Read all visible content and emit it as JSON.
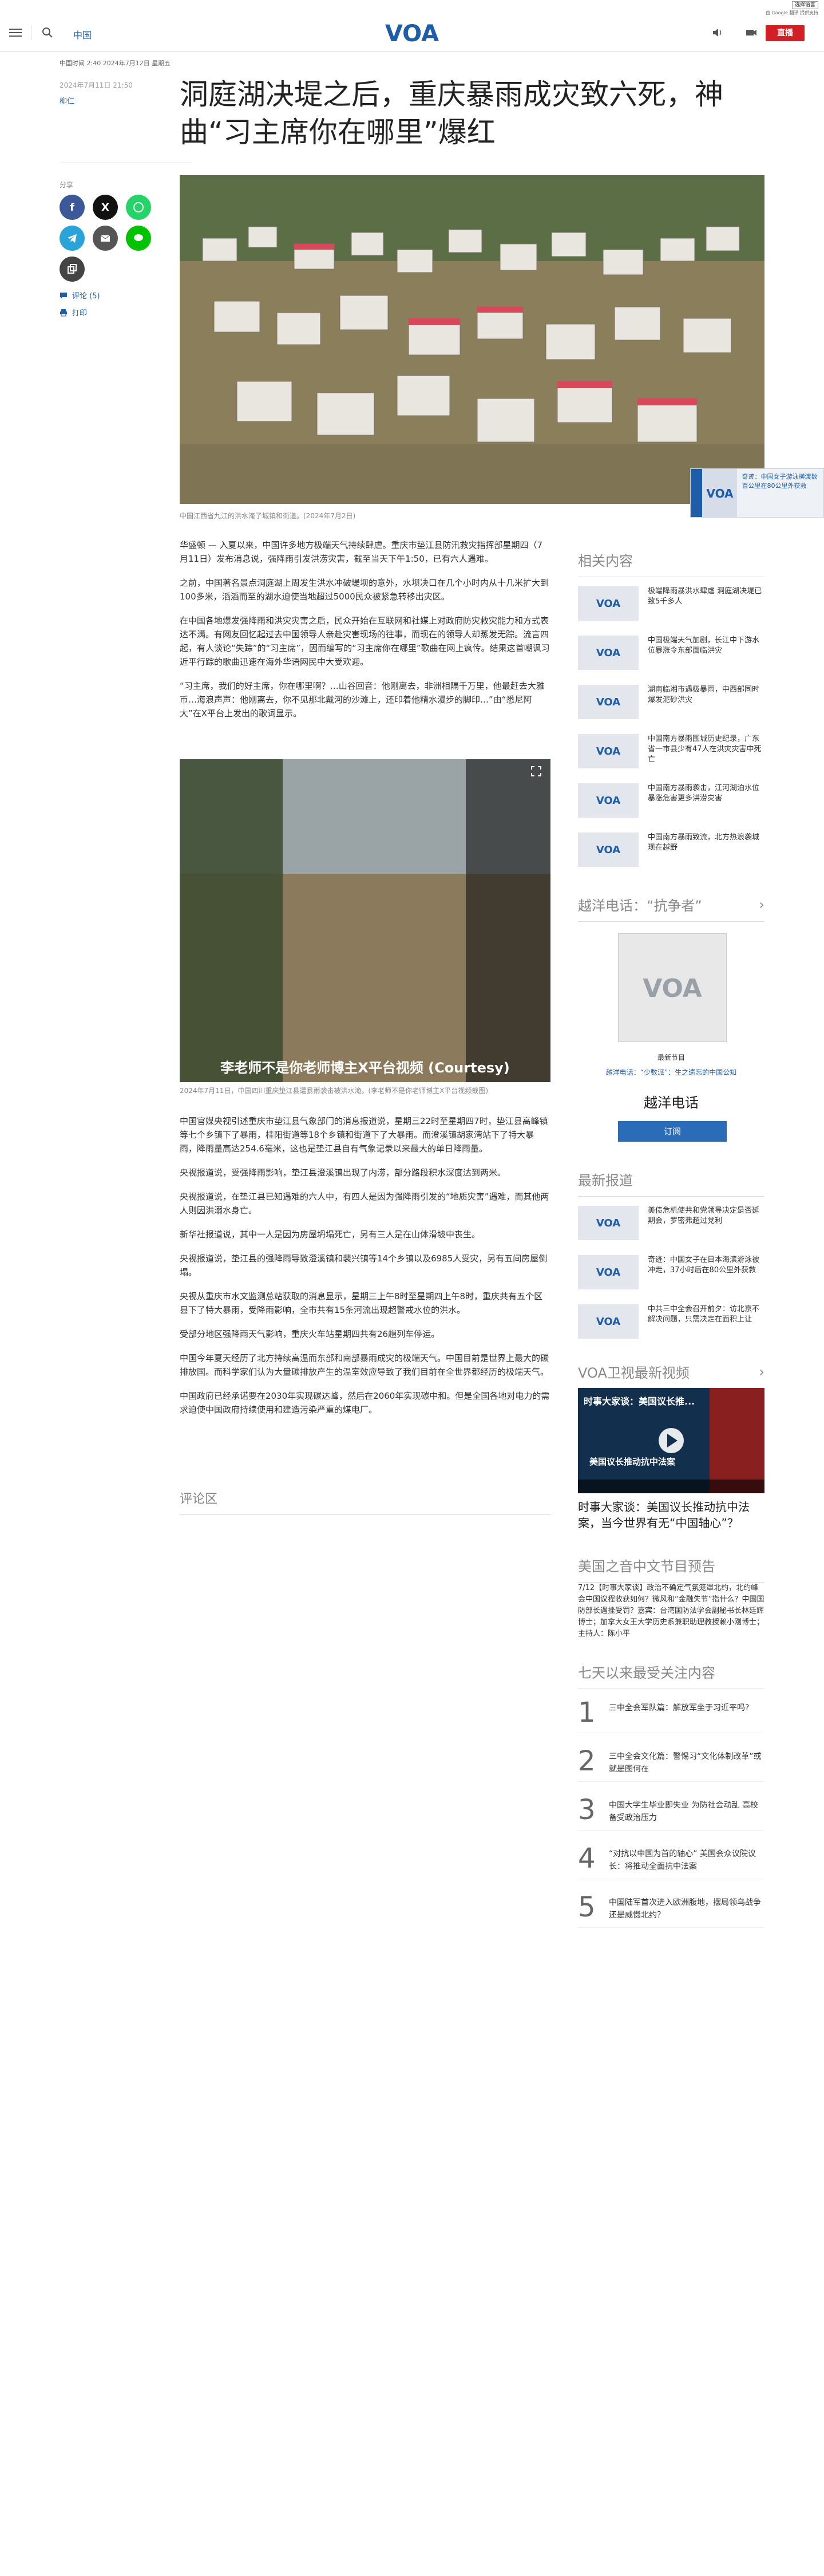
{
  "translate": {
    "select_label": "选择语言",
    "powered_by": "由 Google 翻译 提供支持"
  },
  "header": {
    "language_link": "中国",
    "live_label": "直播"
  },
  "article": {
    "dateline": "中国时间 2:40 2024年7月12日 星期五",
    "published": "2024年7月11日 21:50",
    "author": "柳仁",
    "headline": "洞庭湖决堤之后，重庆暴雨成灾致六死，神曲“习主席你在哪里”爆红",
    "share_label": "分享",
    "comments_label": "评论 (5)",
    "print_label": "打印",
    "lead_caption": "中国江西省九江的洪水淹了城镇和街道。(2024年7月2日)",
    "paragraphs_top": [
      "华盛顿 — 入夏以来，中国许多地方极端天气持续肆虐。重庆市垫江县防汛救灾指挥部星期四（7月11日）发布消息说，强降雨引发洪涝灾害，截至当天下午1:50，已有六人遇难。",
      "之前，中国著名景点洞庭湖上周发生洪水冲破堤坝的意外，水坝决口在几个小时内从十几米扩大到100多米，滔滔而至的湖水迫使当地超过5000民众被紧急转移出灾区。",
      "在中国各地爆发强降雨和洪灾灾害之后，民众开始在互联网和社媒上对政府防灾救灾能力和方式表达不满。有网友回忆起过去中国领导人亲赴灾害现场的往事，而现在的领导人却蒸发无踪。流言四起，有人谈论“失踪”的“习主席”，因而编写的“习主席你在哪里”歌曲在网上疯传。结果这首嘲讽习近平行踪的歌曲迅速在海外华语网民中大受欢迎。",
      "“习主席，我们的好主席，你在哪里啊？…山谷回音：他刚离去，非洲相隔千万里，他最赶去大雅币…海浪声声：他刚离去，你不见那北戴河的沙滩上，还印着他精水漫步的脚印…”由“悉尼阿大”在X平台上发出的歌词显示。"
    ],
    "video_overlay_text": "李老师不是你老师博主X平台视频 (Courtesy)",
    "video_caption": "2024年7月11日，中国四川重庆垫江县遭暴雨袭击被洪水淹。(李老师不是你老师博主X平台视频截图)",
    "paragraphs_bottom": [
      "中国官媒央视引述重庆市垫江县气象部门的消息报道说，星期三22时至星期四7时，垫江县高峰镇等七个乡镇下了暴雨，桂阳街道等18个乡镇和街道下了大暴雨。而澄溪镇胡家湾站下了特大暴雨，降雨量高达254.6毫米，这也是垫江县自有气象记录以来最大的单日降雨量。",
      "央视报道说，受强降雨影响，垫江县澄溪镇出现了内涝，部分路段积水深度达到两米。",
      "央视报道说，在垫江县已知遇难的六人中，有四人是因为强降雨引发的“地质灾害”遇难，而其他两人则因洪溺水身亡。",
      "新华社报道说，其中一人是因为房屋坍塌死亡，另有三人是在山体滑坡中丧生。",
      "央视报道说，垫江县的强降雨导致澄溪镇和裴兴镇等14个乡镇以及6985人受灾，另有五间房屋倒塌。",
      "央视从重庆市水文监测总站获取的消息显示，星期三上午8时至星期四上午8时，重庆共有五个区县下了特大暴雨，受降雨影响，全市共有15条河流出现超警戒水位的洪水。",
      "受部分地区强降雨天气影响，重庆火车站星期四共有26趟列车停运。",
      "中国今年夏天经历了北方持续高温而东部和南部暴雨成灾的极端天气。中国目前是世界上最大的碳排放国。而科学家们认为大量碳排放产生的温室效应导致了我们目前在全世界都经历的极端天气。",
      "中国政府已经承诺要在2030年实现碳达峰，然后在2060年实现碳中和。但是全国各地对电力的需求迫使中国政府持续使用和建造污染严重的煤电厂。"
    ],
    "comment_zone_label": "评论区"
  },
  "float_card": {
    "text": "奇迹：中国女子游泳横渡数百公里在80公里外获救"
  },
  "sidebar": {
    "related_heading": "相关内容",
    "related": [
      "极端降雨暴洪水肆虐 洞庭湖决堤已致5千多人",
      "中国极端天气加剧，长江中下游水位暴涨令东部面临洪灾",
      "湖南临湘市遇极暴雨，中西部同时爆发泥砂洪灾",
      "中国南方暴雨围城历史纪录，广东省一市县少有47人在洪灾灾害中死亡",
      "中国南方暴雨袭击，江河湖泊水位暴涨危害更多洪涝灾害",
      "中国南方暴雨致流，北方热浪袭城现在越野"
    ],
    "hotline_heading": "越洋电话：“抗争者”",
    "program_label": "最新节目",
    "program_line": "越洋电话：“少数派”：生之遗忘的中国公知",
    "program_name": "越洋电话",
    "subscribe_label": "订阅",
    "latest_heading": "最新报道",
    "latest": [
      "美债危机使共和党领导决定是否延期会，罗密弗超过党利",
      "奇迹：中国女子在日本海滨游泳被冲走，37小时后在80公里外获救",
      "中共三中全会召开前夕：访北京不解决问题，只需决定在面积上让"
    ],
    "tv_heading": "VOA卫视最新视频",
    "tv_video_overlay": "时事大家谈：美国议长推...",
    "tv_video_sub": "美国议长推动抗中法案",
    "tv_title": "时事大家谈：美国议长推动抗中法案，当今世界有无“中国轴心”？",
    "preview_heading": "美国之音中文节目预告",
    "preview_text": "7/12【时事大家谈】政治不确定气氛笼罩北约，北约峰会中国议程收获如何？微风和“金融失节”指什么？中国国防部长遇挫受罚？嘉宾：台湾国防法学会副秘书长林廷辉博士；加拿大女王大学历史系兼职助理教授赖小刚博士；主持人：陈小平",
    "rank_heading": "七天以来最受关注内容",
    "ranked": [
      {
        "num": "1",
        "text": "三中全会军队篇：解放军坐于习近平吗?"
      },
      {
        "num": "2",
        "text": "三中全会文化篇：警惕习“文化体制改革”或就是图何在"
      },
      {
        "num": "3",
        "text": "中国大学生毕业即失业 为防社会动乱 高校备受政治压力"
      },
      {
        "num": "4",
        "text": "“对抗以中国为首的轴心” 美国会众议院议长：将推动全面抗中法案"
      },
      {
        "num": "5",
        "text": "中国陆军首次进入欧洲腹地，摆局领乌战争还是威慑北约？"
      }
    ]
  },
  "colors": {
    "brand_blue": "#1d5da9",
    "live_red": "#d21f26",
    "facebook": "#3b5998",
    "x": "#111111",
    "whatsapp": "#25d366",
    "telegram": "#2aa3d8",
    "email": "#555555",
    "line": "#00c300"
  }
}
